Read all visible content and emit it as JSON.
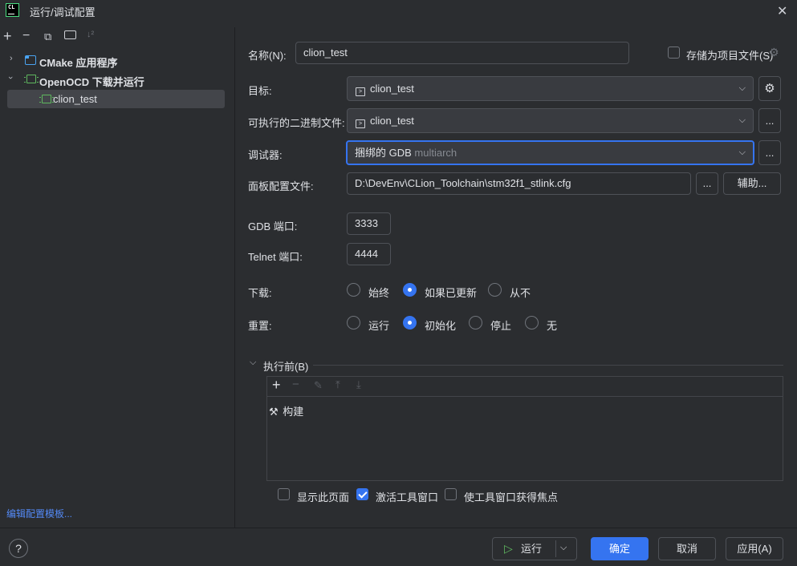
{
  "window": {
    "title": "运行/调试配置",
    "logo": "CL"
  },
  "toolbar_left": {
    "add": "+",
    "remove": "−",
    "copy": "⧉",
    "folder": "📁",
    "sort": "↓²"
  },
  "tree": {
    "items": [
      {
        "label": "CMake 应用程序",
        "icon": "cmake-icon",
        "expanded": false
      },
      {
        "label": "OpenOCD 下载并运行",
        "icon": "chip-icon",
        "expanded": true
      },
      {
        "label": "clion_test",
        "icon": "chip-icon",
        "selected": true
      }
    ]
  },
  "edit_templates": "编辑配置模板...",
  "form": {
    "name_label": "名称(N):",
    "name_value": "clion_test",
    "store_label": "存储为项目文件(S)",
    "target_label": "目标:",
    "target_value": "clion_test",
    "exec_label": "可执行的二进制文件:",
    "exec_value": "clion_test",
    "debugger_label": "调试器:",
    "debugger_value": "捆绑的 GDB",
    "debugger_hint": "multiarch",
    "board_label": "面板配置文件:",
    "board_value": "D:\\DevEnv\\CLion_Toolchain\\stm32f1_stlink.cfg",
    "ellipsis": "...",
    "assist_label": "辅助...",
    "gdb_port_label": "GDB 端口:",
    "gdb_port_value": "3333",
    "telnet_port_label": "Telnet 端口:",
    "telnet_port_value": "4444",
    "download_label": "下载:",
    "download_options": [
      "始终",
      "如果已更新",
      "从不"
    ],
    "download_selected": "如果已更新",
    "reset_label": "重置:",
    "reset_options": [
      "运行",
      "初始化",
      "停止",
      "无"
    ],
    "reset_selected": "初始化"
  },
  "before_launch": {
    "label": "执行前(B)",
    "task": "构建",
    "show_page": "显示此页面",
    "show_page_checked": false,
    "activate_window": "激活工具窗口",
    "activate_window_checked": true,
    "focus_window": "使工具窗口获得焦点",
    "focus_window_checked": false
  },
  "footer": {
    "help": "?",
    "run": "运行",
    "ok": "确定",
    "cancel": "取消",
    "apply": "应用(A)"
  },
  "colors": {
    "accent": "#3574f0",
    "bg": "#2b2d30",
    "link": "#548af7"
  }
}
